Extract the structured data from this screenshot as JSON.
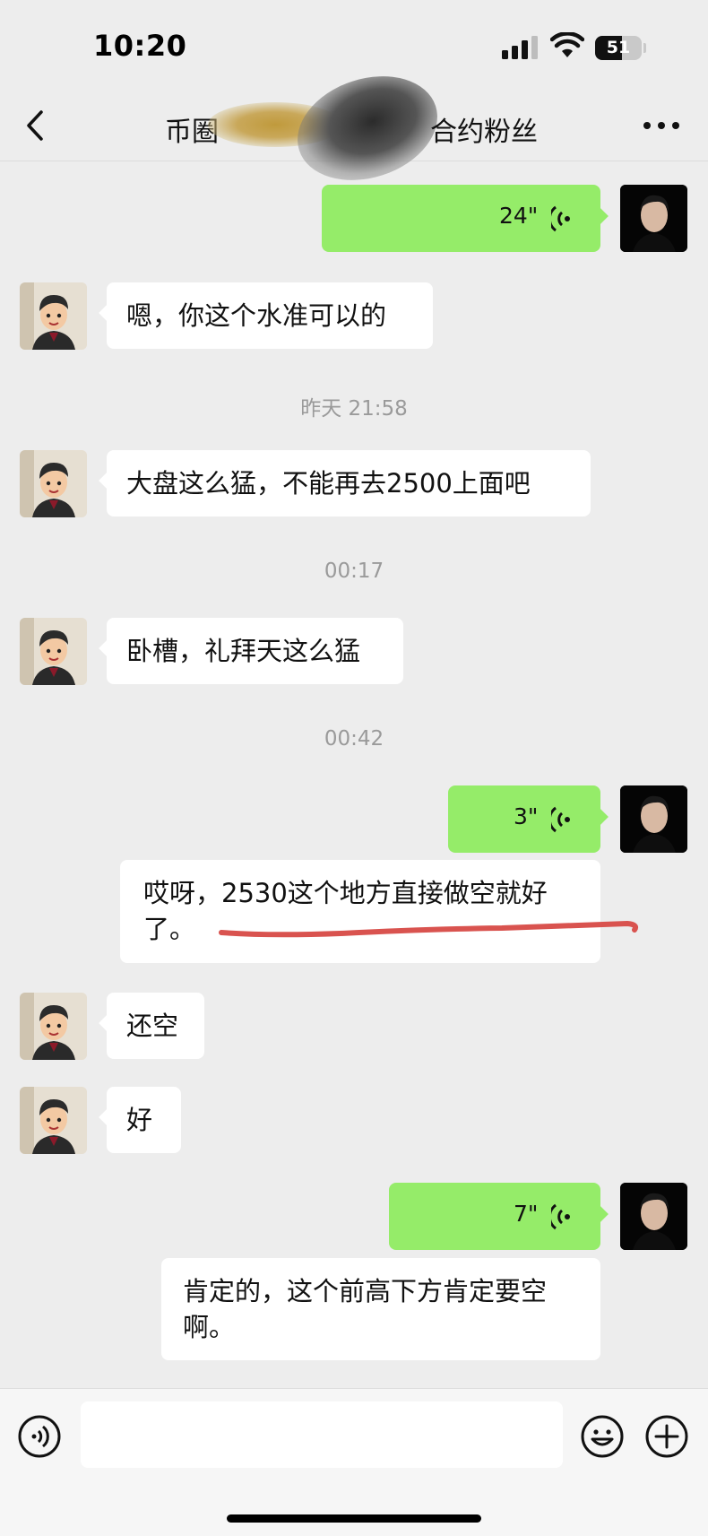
{
  "status_bar": {
    "time": "10:20",
    "battery_level": "51",
    "icons": [
      "cellular-signal-icon",
      "wifi-icon",
      "battery-icon"
    ]
  },
  "nav": {
    "title_left": "币圈",
    "title_right": "合约粉丝",
    "back_icon": "chevron-left-icon",
    "more_icon": "more-icon"
  },
  "messages": [
    {
      "sender": "self",
      "kind": "voice",
      "duration": "24\""
    },
    {
      "sender": "friend",
      "kind": "text",
      "text": "嗯，你这个水准可以的"
    },
    {
      "kind": "timestamp",
      "text": "昨天 21:58"
    },
    {
      "sender": "friend",
      "kind": "text",
      "text": "大盘这么猛，不能再去2500上面吧"
    },
    {
      "kind": "timestamp",
      "text": "00:17"
    },
    {
      "sender": "friend",
      "kind": "text",
      "text": "卧槽，礼拜天这么猛"
    },
    {
      "kind": "timestamp",
      "text": "00:42"
    },
    {
      "sender": "self",
      "kind": "voice",
      "duration": "3\""
    },
    {
      "sender": "self",
      "kind": "voice-transcript",
      "text_line1": "哎呀，2530这个地方直接做空就好",
      "text_line2": "了。"
    },
    {
      "sender": "friend",
      "kind": "text",
      "text": "还空"
    },
    {
      "sender": "friend",
      "kind": "text",
      "text": "好"
    },
    {
      "sender": "self",
      "kind": "voice",
      "duration": "7\""
    },
    {
      "sender": "self",
      "kind": "voice-transcript",
      "text_line1": "肯定的，这个前高下方肯定要空",
      "text_line2": "啊。"
    }
  ],
  "input_bar": {
    "placeholder": "",
    "icons": [
      "voice-input-icon",
      "emoji-icon",
      "plus-icon"
    ]
  },
  "colors": {
    "background": "#ededed",
    "self_bubble": "#95ec69",
    "friend_bubble": "#ffffff",
    "annotation_underline": "#d9534f"
  }
}
